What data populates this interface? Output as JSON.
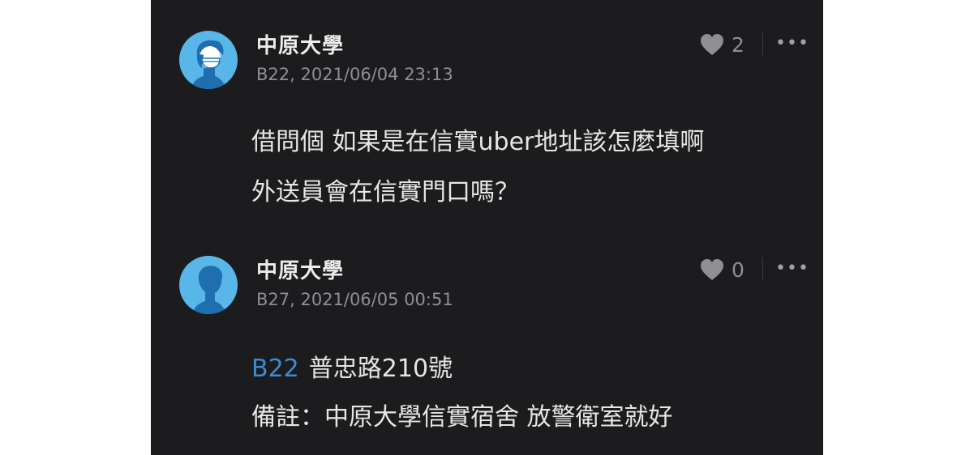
{
  "comments": [
    {
      "author": "中原大學",
      "floor_time": "B22, 2021/06/04 23:13",
      "likes": "2",
      "more_label": "•••",
      "avatar": "masked-user-avatar",
      "lines": [
        "借問個 如果是在信實uber地址該怎麼填啊",
        "外送員會在信實門口嗎？"
      ]
    },
    {
      "author": "中原大學",
      "floor_time": "B27, 2021/06/05 00:51",
      "likes": "0",
      "more_label": "•••",
      "avatar": "user-avatar",
      "reply_to": "B22",
      "lines": [
        "普忠路210號",
        "備註：中原大學信實宿舍 放警衛室就好"
      ]
    }
  ],
  "colors": {
    "background": "#1c1c1e",
    "avatar_bg": "#58b6e8",
    "avatar_figure": "#1f6fb0",
    "reply_link": "#3a8bd0",
    "muted": "#8e8e93"
  }
}
